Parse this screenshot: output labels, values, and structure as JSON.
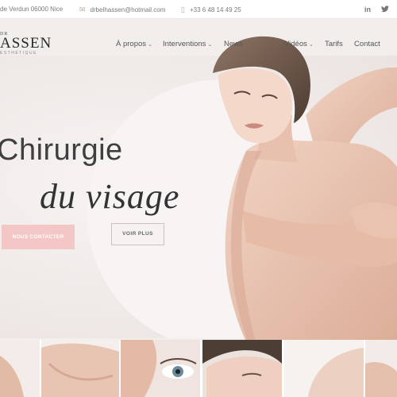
{
  "topbar": {
    "address": "de Verdun 06000 Nice",
    "email": "drbelhassen@hotmail.com",
    "phone": "+33 6 48 14 49 25",
    "social": [
      "in",
      "•"
    ]
  },
  "logo": {
    "small": "DR",
    "main": "ASSEN",
    "sub": "ESTHÉTIQUE"
  },
  "nav": {
    "items": [
      "À propos",
      "Interventions",
      "News",
      "Vidéos",
      "Tarifs",
      "Contact"
    ]
  },
  "hero": {
    "title_line1": "Chirurgie",
    "title_line2": "du visage",
    "cta_primary": "NOUS CONTACTER",
    "cta_secondary": "VOIR PLUS"
  },
  "colors": {
    "accent": "#f2c7c5",
    "background": "#f2eeec"
  }
}
